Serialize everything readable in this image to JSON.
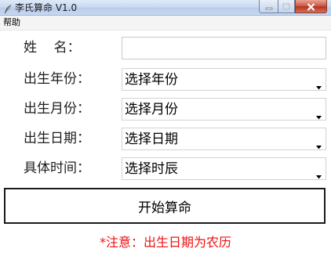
{
  "window": {
    "title": "李氏算命 V1.0",
    "icon": "feather-icon",
    "buttons": [
      "minimize-icon",
      "maximize-icon",
      "close-icon"
    ]
  },
  "menu": {
    "items": [
      {
        "label": "帮助"
      }
    ]
  },
  "form": {
    "name_label": "姓    名：",
    "name_value": "",
    "year_label": "出生年份：",
    "year_value": "选择年份",
    "month_label": "出生月份：",
    "month_value": "选择月份",
    "day_label": "出生日期：",
    "day_value": "选择日期",
    "time_label": "具体时间：",
    "time_value": "选择时辰"
  },
  "actions": {
    "start_label": "开始算命"
  },
  "notice": {
    "text": "*注意：出生日期为农历",
    "color": "#ee1111"
  }
}
